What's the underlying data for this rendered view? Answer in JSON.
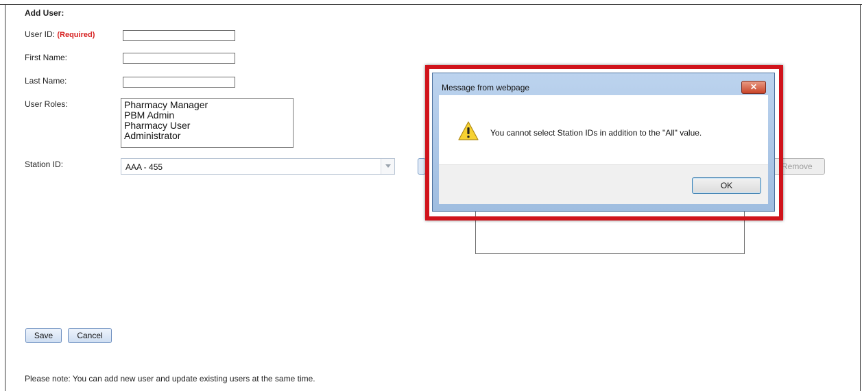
{
  "form": {
    "title": "Add User:",
    "user_id_label": "User ID:",
    "required_label": "(Required)",
    "user_id_value": "",
    "first_name_label": "First Name:",
    "first_name_value": "",
    "last_name_label": "Last Name:",
    "last_name_value": "",
    "user_roles_label": "User Roles:",
    "roles": [
      "Pharmacy Manager",
      "PBM Admin",
      "Pharmacy User",
      "Administrator"
    ],
    "station_id_label": "Station ID:",
    "station_id_value": "AAA - 455",
    "remove_label": "Remove",
    "save_label": "Save",
    "cancel_label": "Cancel",
    "note": "Please note: You can add new user and update existing users at the same time."
  },
  "dialog": {
    "title": "Message from webpage",
    "close_label": "✕",
    "icon": "warning-icon",
    "message": "You cannot select Station IDs in addition to the \"All\" value.",
    "ok_label": "OK"
  },
  "colors": {
    "required": "#d62020",
    "highlight": "#d0131b",
    "dialog_frame": "#bcd3ee"
  }
}
